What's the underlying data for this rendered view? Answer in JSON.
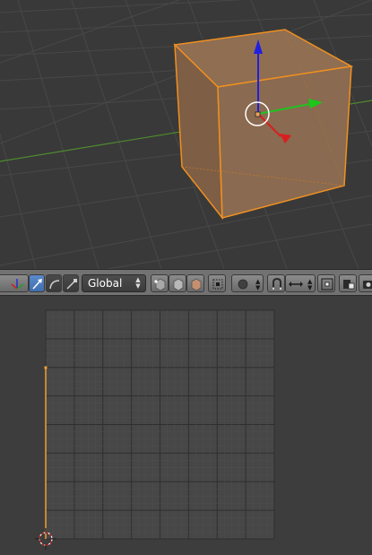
{
  "viewport": {
    "colors": {
      "background": "#393939",
      "grid": "#484848",
      "x_axis_line": "#4e8a2e",
      "cube_face": "#8a6a50",
      "cube_edge": "#f09020",
      "arrow_x_red": "#d81f1f",
      "arrow_y_green": "#19c819",
      "arrow_z_blue": "#1a1ad8"
    },
    "manipulator_icons": [
      "transform-pivot-icon",
      "translate-arrow-icon",
      "rotate-arc-icon",
      "scale-handle-icon"
    ]
  },
  "header": {
    "transform_orientation": {
      "selected": "Global"
    },
    "icons": {
      "select_modes": [
        "vertex-select-icon",
        "edge-select-icon",
        "face-select-icon"
      ],
      "occlude": "occlude-geometry-icon",
      "proportional": "proportional-editing-icon",
      "snap": "snap-magnet-icon",
      "snap_element": "snap-element-icon",
      "snap_target": "snap-target-icon",
      "render_preview": "render-icon",
      "camera": "camera-icon"
    }
  },
  "uv_editor": {
    "colors": {
      "background": "#3d3d3d",
      "image_area": "#474747",
      "grid_line": "#545454",
      "uv_edge": "#f0a030"
    },
    "cursor_icon": "2d-cursor-icon"
  }
}
